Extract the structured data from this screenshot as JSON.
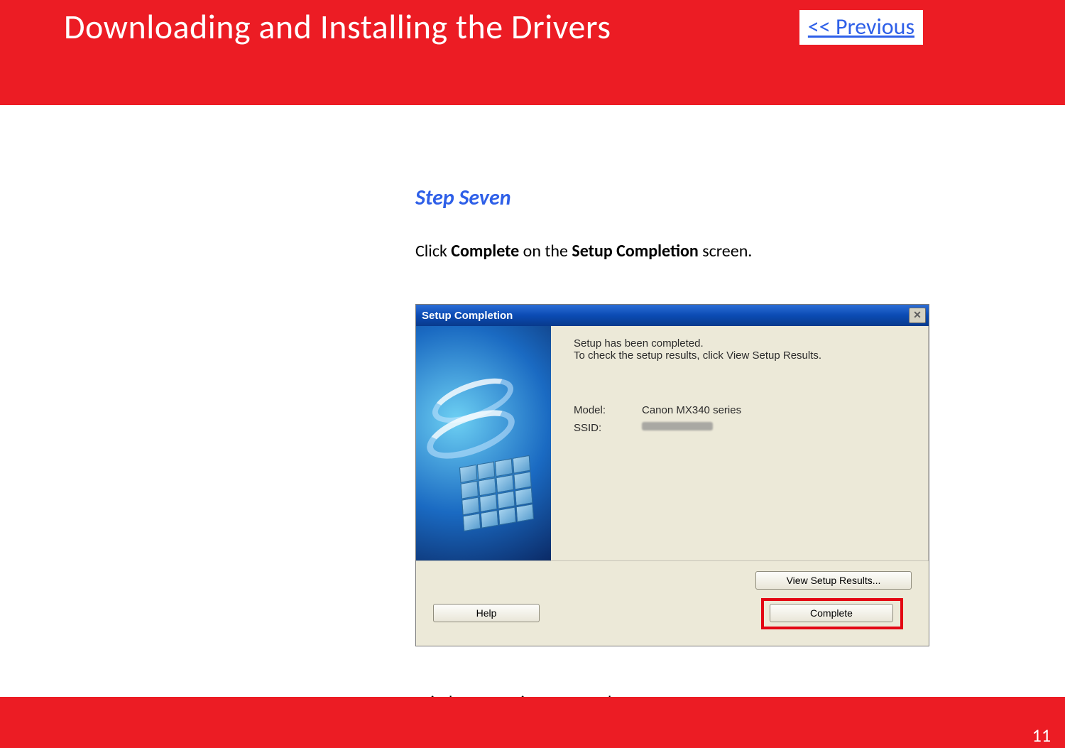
{
  "header": {
    "title": "Downloading and Installing  the Drivers",
    "prev_label": " << Previous"
  },
  "step": {
    "heading": "Step Seven",
    "instr_prefix": "Click ",
    "instr_bold1": "Complete",
    "instr_mid": " on the ",
    "instr_bold2": "Setup Completion",
    "instr_suffix": " screen.",
    "conclusion": "Wireless setup is now complete."
  },
  "dialog": {
    "title": "Setup Completion",
    "line1": "Setup has been completed.",
    "line2": "To check the setup results, click View Setup Results.",
    "model_label": "Model:",
    "model_value": "Canon MX340 series",
    "ssid_label": "SSID:",
    "btn_view": "View Setup Results...",
    "btn_help": "Help",
    "btn_complete": "Complete",
    "close_glyph": "✕"
  },
  "footer": {
    "page_number": "11"
  }
}
